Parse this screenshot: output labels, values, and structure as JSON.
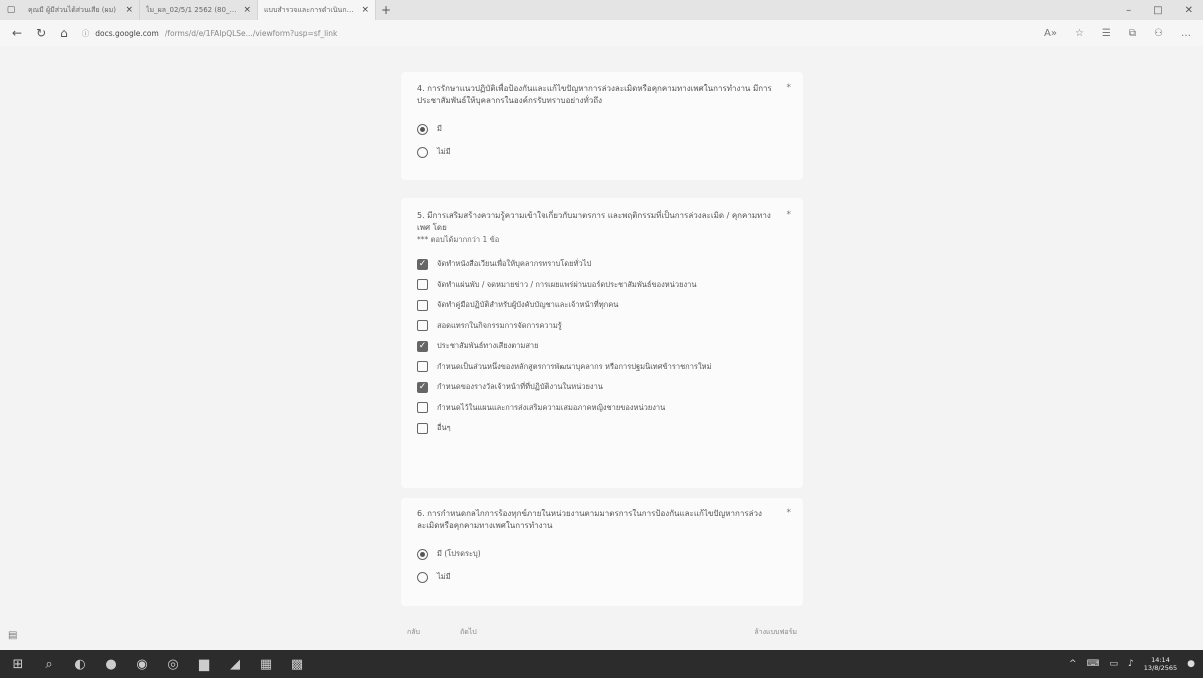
{
  "browser": {
    "tabs": [
      {
        "title": "คุณมี ผู้มีส่วนได้ส่วนเสีย (ผม)"
      },
      {
        "title": "ไม_ผล_02/5/1 2562 (80_6_65).pdf"
      },
      {
        "title": "แบบสำรวจและการดำเนินการตามมาตรา"
      }
    ],
    "new_tab": "+",
    "window_controls": [
      "–",
      "□",
      "✕"
    ],
    "url_domain": "docs.google.com",
    "url_rest": "/forms/d/e/1FAIpQLSe.../viewform?usp=sf_link"
  },
  "form": {
    "q4": {
      "title": "4. การรักษาแนวปฏิบัติเพื่อป้องกันและแก้ไขปัญหาการล่วงละเมิดหรือคุกคามทางเพศในการทำงาน มีการประชาสัมพันธ์ให้บุคลากรในองค์กรรับทราบอย่างทั่วถึง",
      "required": "*",
      "options": [
        {
          "label": "มี",
          "selected": true
        },
        {
          "label": "ไม่มี",
          "selected": false
        }
      ]
    },
    "q5": {
      "title": "5. มีการเสริมสร้างความรู้ความเข้าใจเกี่ยวกับมาตรการ และพฤติกรรมที่เป็นการล่วงละเมิด / คุกคามทางเพศ โดย",
      "note": "*** ตอบได้มากกว่า 1 ข้อ",
      "required": "*",
      "options": [
        {
          "label": "จัดทำหนังสือเวียนเพื่อให้บุคลากรทราบโดยทั่วไป",
          "checked": true
        },
        {
          "label": "จัดทำแผ่นพับ / จดหมายข่าว / การเผยแพร่ผ่านบอร์ดประชาสัมพันธ์ของหน่วยงาน",
          "checked": false
        },
        {
          "label": "จัดทำคู่มือปฏิบัติสำหรับผู้บังคับบัญชาและเจ้าหน้าที่ทุกคน",
          "checked": false
        },
        {
          "label": "สอดแทรกในกิจกรรมการจัดการความรู้",
          "checked": false
        },
        {
          "label": "ประชาสัมพันธ์ทางเสียงตามสาย",
          "checked": true
        },
        {
          "label": "กำหนดเป็นส่วนหนึ่งของหลักสูตรการพัฒนาบุคลากร หรือการปฐมนิเทศข้าราชการใหม่",
          "checked": false
        },
        {
          "label": "กำหนดของรางวัลเจ้าหน้าที่ที่ปฏิบัติงานในหน่วยงาน",
          "checked": true
        },
        {
          "label": "กำหนดไว้ในแผนและการส่งเสริมความเสมอภาคหญิงชายของหน่วยงาน",
          "checked": false
        },
        {
          "label": "อื่นๆ",
          "checked": false
        }
      ]
    },
    "q6": {
      "title": "6. การกำหนดกลไกการร้องทุกข์ภายในหน่วยงานตามมาตรการในการป้องกันและแก้ไขปัญหาการล่วงละเมิดหรือคุกคามทางเพศในการทำงาน",
      "required": "*",
      "options": [
        {
          "label": "มี (โปรดระบุ)",
          "selected": true
        },
        {
          "label": "ไม่มี",
          "selected": false
        }
      ]
    },
    "footer": {
      "back": "กลับ",
      "next": "ถัดไป",
      "clear": "ล้างแบบฟอร์ม"
    }
  },
  "taskbar": {
    "time": "14:14",
    "date": "13/8/2565"
  }
}
